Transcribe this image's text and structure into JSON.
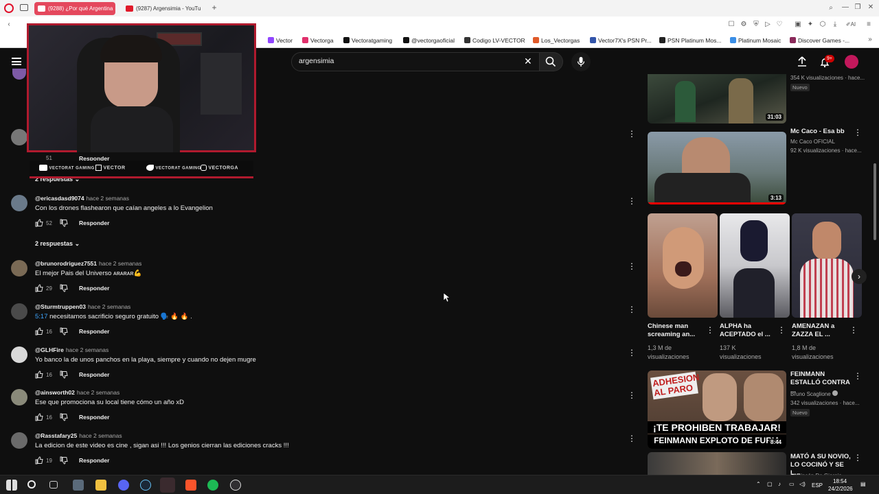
{
  "browser": {
    "tabs": [
      {
        "label": "(9288) ¿Por qué Argentina"
      },
      {
        "label": "(9287) Argensimia - YouTu"
      }
    ],
    "new_tab": "+"
  },
  "bookmarks": [
    {
      "label": "Vector",
      "color": "#9146ff"
    },
    {
      "label": "Vectorga",
      "color": "#e1306c"
    },
    {
      "label": "Vectoratgaming",
      "color": "#111111"
    },
    {
      "label": "@vectorgaoficial",
      "color": "#111111"
    },
    {
      "label": "Codigo LV-VECTOR",
      "color": "#333333"
    },
    {
      "label": "Los_Vectorgas",
      "color": "#e05a2a"
    },
    {
      "label": "Vector7X's PSN Pr...",
      "color": "#3355aa"
    },
    {
      "label": "PSN Platinum Mos...",
      "color": "#222222"
    },
    {
      "label": "Platinum Mosaic",
      "color": "#3a8ee6"
    },
    {
      "label": "Discover Games -...",
      "color": "#8a2a5a"
    }
  ],
  "search": {
    "value": "argensimia",
    "placeholder": "Buscar"
  },
  "header": {
    "notif_badge": "9+"
  },
  "overlay": {
    "socials": [
      {
        "label": "VECTORAT GAMING"
      },
      {
        "label": "VECTOR"
      },
      {
        "label": "VECTORAT GAMING"
      },
      {
        "label": "VECTORGA"
      }
    ]
  },
  "partial_comment": {
    "likes": "51",
    "reply": "Responder",
    "replies_toggle": "2 respuestas"
  },
  "comments": [
    {
      "handle": "@ericasdasd9074",
      "time": "hace 2 semanas",
      "text": "Con los drones flashearon que caían angeles a lo Evangelion",
      "likes": "52",
      "reply": "Responder",
      "replies": "2 respuestas",
      "avatar": "#6a7a8a"
    },
    {
      "handle": "@brunorodriguez7551",
      "time": "hace 2 semanas",
      "text": "El mejor Pais del Universo ᴀʀᴀʀᴀʀ💪",
      "likes": "29",
      "reply": "Responder",
      "avatar": "#7a6a55"
    },
    {
      "handle": "@Sturmtruppen03",
      "time": "hace 2 semanas",
      "timestamp": "5:17",
      "text": "necesitamos sacrificio seguro gratuito 🗣️ 🔥 🔥 .",
      "likes": "16",
      "reply": "Responder",
      "avatar": "#4a4a4a"
    },
    {
      "handle": "@GLHFire",
      "time": "hace 2 semanas",
      "text": "Yo banco la de unos panchos en la playa, siempre y cuando no dejen mugre",
      "likes": "16",
      "reply": "Responder",
      "avatar": "#d8d8d8"
    },
    {
      "handle": "@ainsworth02",
      "time": "hace 2 semanas",
      "text": "Ese que promociona su local tiene cómo un año xD",
      "likes": "16",
      "reply": "Responder",
      "avatar": "#8a8a7a"
    },
    {
      "handle": "@Rasstafary25",
      "time": "hace 2 semanas",
      "text": "La edicion de este video es cine , sigan asi !!!  Los genios cierran las ediciones cracks !!!",
      "likes": "19",
      "reply": "Responder",
      "avatar": "#6a6a6a"
    }
  ],
  "sidebar": {
    "top_video": {
      "meta": "354 K visualizaciones · hace...",
      "badge": "Nuevo",
      "duration": "31:03"
    },
    "video2": {
      "title": "Mc Caco - Esa bb",
      "channel": "Mc Caco OFICIAL",
      "meta": "92 K visualizaciones · hace...",
      "duration": "3:13"
    },
    "shorts": [
      {
        "title": "Chinese man screaming an...",
        "views": "1,3 M de visualizaciones"
      },
      {
        "title": "ALPHA ha ACEPTADO el ...",
        "views": "137 K visualizaciones"
      },
      {
        "title": "AMENAZAN a ZAZZA EL ...",
        "views": "1,8 M de visualizaciones"
      }
    ],
    "video3": {
      "title": "FEINMANN ESTALLÓ CONTRA ...",
      "channel": "Bruno Scaglione",
      "meta": "342 visualizaciones · hace...",
      "badge": "Nuevo",
      "thumb_top": "ADHESION AL PARO",
      "thumb_banner1": "¡TE PROHIBEN TRABAJAR!",
      "thumb_banner2": "FEINMANN EXPLOTO DE FURIA",
      "duration": "8:44"
    },
    "video4": {
      "title": "MATÓ A SU NOVIO, LO COCINÓ Y SE L...",
      "channel": "El Rincón De Giorgio"
    }
  },
  "taskbar": {
    "lang": "ESP",
    "time": "18:54",
    "date": "24/2/2026"
  }
}
